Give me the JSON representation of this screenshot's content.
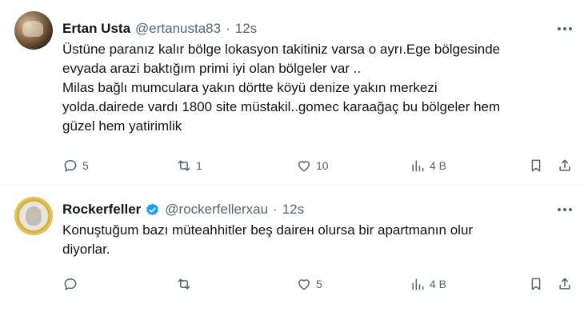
{
  "tweets": [
    {
      "display_name": "Ertan Usta",
      "handle": "@ertanusta83",
      "separator": "·",
      "time": "12s",
      "verified": false,
      "lines": [
        "Üstüne paranız kalır bölge lokasyon takitiniz varsa o ayrı.Ege bölgesinde",
        "evyada arazi baktığım primi iyi olan bölgeler var ..",
        "Milas bağlı mumculara yakın dörtte köyü denize yakın merkezi",
        "yoldа.dairede vardı 1800 site müstakil..gomec karaağaç bu bölgeler hem",
        "güzel hem yatirimlik"
      ],
      "stats": {
        "replies": "5",
        "retweets": "1",
        "likes": "10",
        "views": "4 B"
      }
    },
    {
      "display_name": "Rockerfeller",
      "handle": "@rockerfellerxau",
      "separator": "·",
      "time": "12s",
      "verified": true,
      "lines": [
        "Konuştuğum bazı müteahhitler beş daireн olursa bir apartmanın olur",
        "diyorlar."
      ],
      "stats": {
        "replies": "",
        "retweets": "",
        "likes": "5",
        "views": "4 B"
      }
    }
  ],
  "icons": {
    "reply": "reply-icon",
    "retweet": "retweet-icon",
    "like": "heart-icon",
    "views": "views-icon",
    "bookmark": "bookmark-icon",
    "share": "share-icon",
    "more": "more-icon",
    "verified": "verified-badge-icon"
  },
  "colors": {
    "text": "#0f1419",
    "secondary": "#536471",
    "verified": "#1d9bf0",
    "divider": "#eff3f4"
  }
}
